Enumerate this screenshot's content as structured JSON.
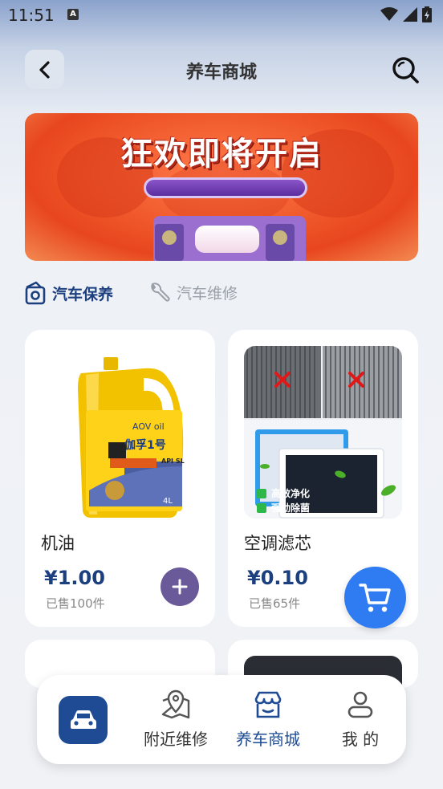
{
  "status_bar": {
    "time": "11:51",
    "notification_badge": "A"
  },
  "header": {
    "title": "养车商城"
  },
  "banner": {
    "headline": "狂欢即将开启"
  },
  "tabs": [
    {
      "label": "汽车保养",
      "active": true
    },
    {
      "label": "汽车维修",
      "active": false
    }
  ],
  "products": [
    {
      "name": "机油",
      "price": "¥1.00",
      "sold": "已售100件"
    },
    {
      "name": "空调滤芯",
      "price": "¥0.10",
      "sold": "已售65件"
    }
  ],
  "oil_label": {
    "brand": "AOV oil",
    "product": "伽孚1号",
    "grade": "API SL",
    "volume": "4L"
  },
  "filter_label": {
    "line1": "高效净化",
    "line2": "强劲除菌"
  },
  "bottom_nav": {
    "items": [
      {
        "label": "附近维修",
        "active": false
      },
      {
        "label": "养车商城",
        "active": true
      },
      {
        "label": "我 的",
        "active": false
      }
    ]
  },
  "colors": {
    "primary": "#1c3f80",
    "accent_blue": "#2f7bf2",
    "add_button": "#6a5a9a",
    "muted": "#9aa0a8"
  }
}
